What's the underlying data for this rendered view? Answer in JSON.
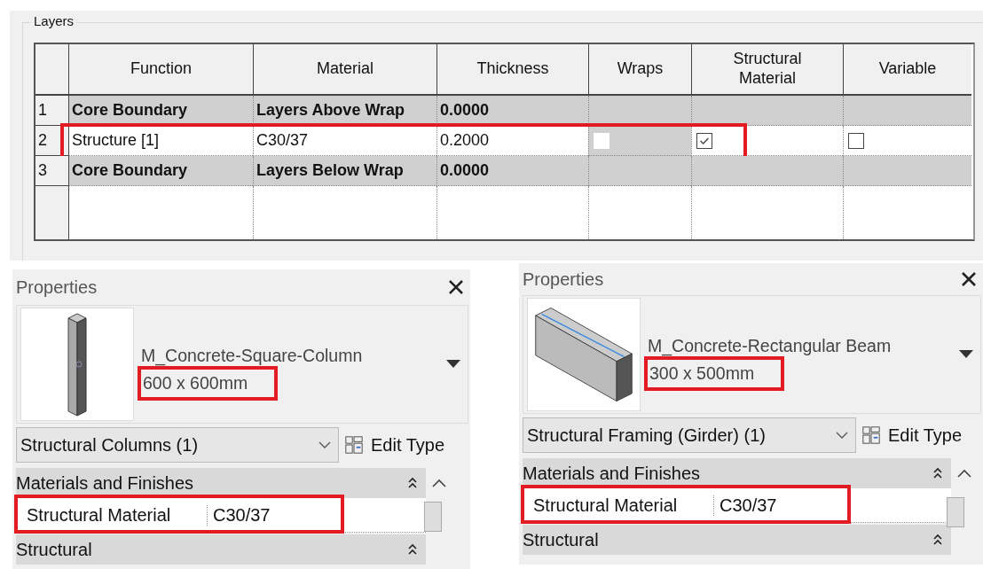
{
  "layers": {
    "title": "Layers",
    "columns": [
      "Function",
      "Material",
      "Thickness",
      "Wraps",
      "Structural Material",
      "Variable"
    ],
    "rows": [
      {
        "number": "1",
        "kind": "boundary",
        "function": "Core Boundary",
        "material": "Layers Above Wrap",
        "thickness": "0.0000",
        "highlighted": false
      },
      {
        "number": "2",
        "kind": "layer",
        "function": "Structure [1]",
        "material": "C30/37",
        "thickness": "0.2000",
        "highlighted": true,
        "wraps": {
          "checked": false,
          "disabled": true
        },
        "structural_material": {
          "checked": true,
          "disabled": false
        },
        "variable": {
          "checked": false,
          "disabled": false
        }
      },
      {
        "number": "3",
        "kind": "boundary",
        "function": "Core Boundary",
        "material": "Layers Below Wrap",
        "thickness": "0.0000",
        "highlighted": false
      }
    ]
  },
  "properties_panels": [
    {
      "title": "Properties",
      "kind": "column",
      "family": "M_Concrete-Square-Column",
      "type_size": "600 x 600mm",
      "size_highlighted": true,
      "category": "Structural Columns (1)",
      "edit_type": "Edit Type",
      "group": "Materials and Finishes",
      "params": [
        {
          "name": "Structural Material",
          "value": "C30/37",
          "highlighted": true
        }
      ],
      "next_group": "Structural"
    },
    {
      "title": "Properties",
      "kind": "beam",
      "family": "M_Concrete-Rectangular Beam",
      "type_size": "300 x 500mm",
      "size_highlighted": true,
      "category": "Structural Framing (Girder) (1)",
      "edit_type": "Edit Type",
      "group": "Materials and Finishes",
      "params": [
        {
          "name": "Structural Material",
          "value": "C30/37",
          "highlighted": true
        }
      ],
      "next_group": "Structural"
    }
  ]
}
